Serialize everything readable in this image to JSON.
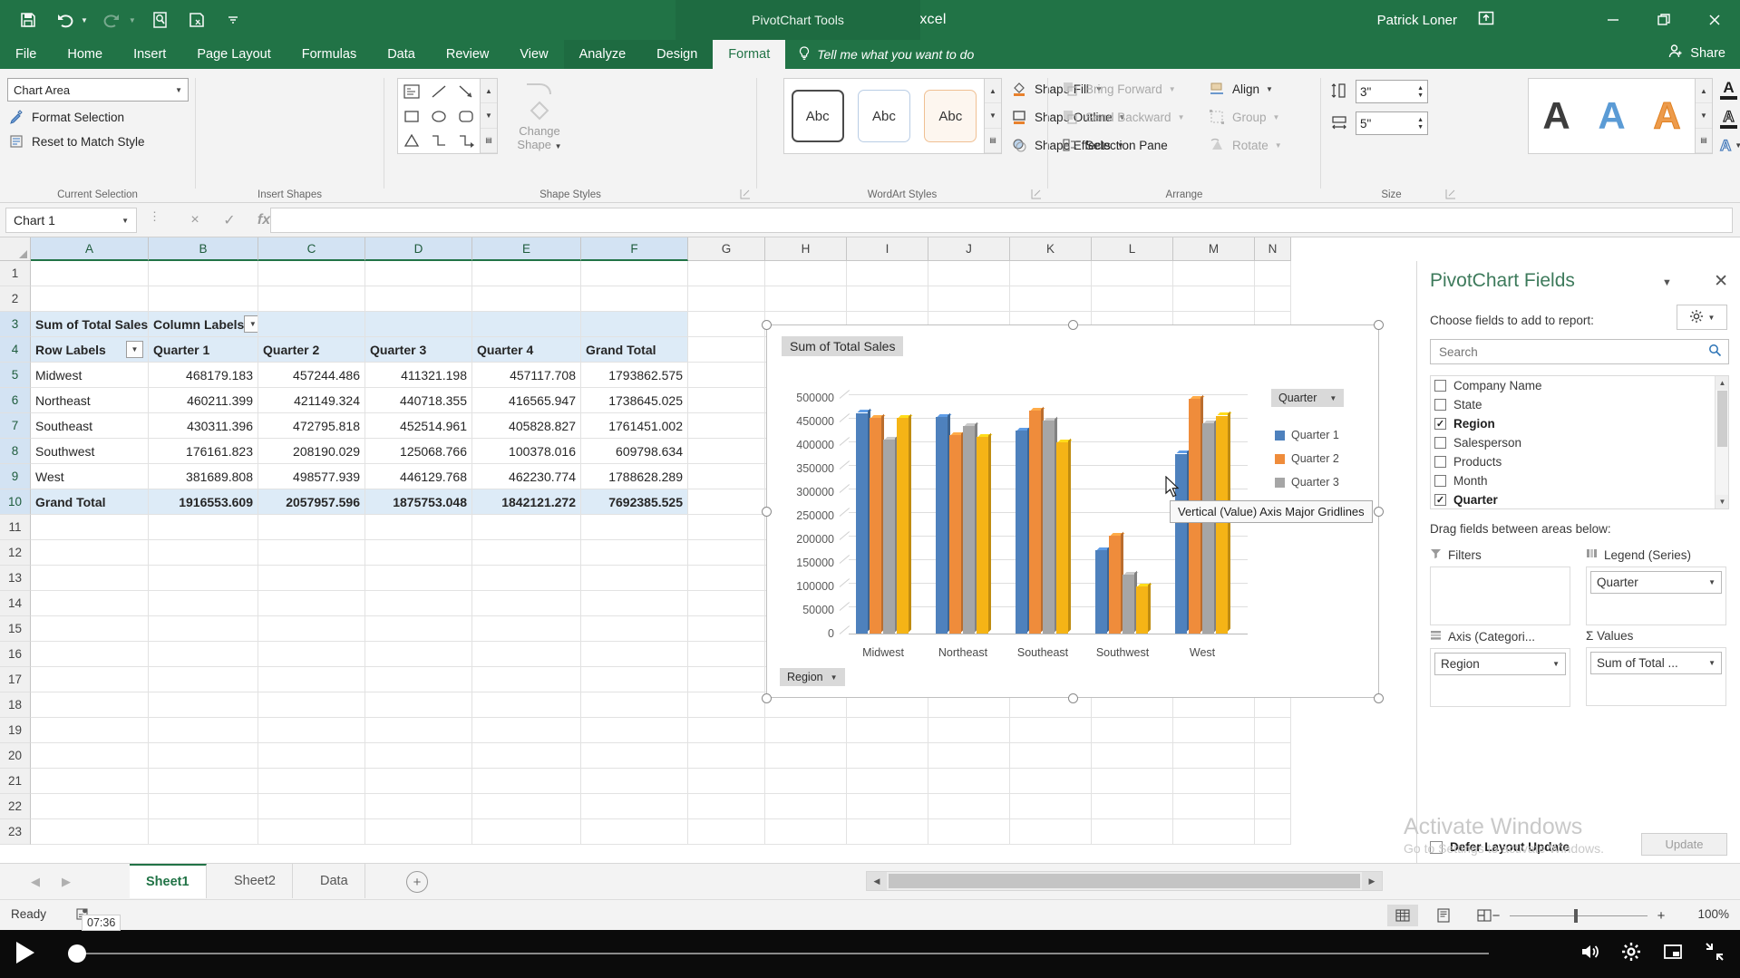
{
  "app": {
    "document_title": "Sales Data.xlsx  -  Excel",
    "context_banner": "PivotChart Tools",
    "account_name": "Patrick Loner",
    "share_label": "Share",
    "tell_me": "Tell me what you want to do"
  },
  "quick_access": [
    {
      "name": "save-icon",
      "enabled": true
    },
    {
      "name": "undo-icon",
      "enabled": true
    },
    {
      "name": "redo-icon",
      "enabled": false
    },
    {
      "name": "print-preview-icon",
      "enabled": true
    },
    {
      "name": "quick-print-icon",
      "enabled": true
    },
    {
      "name": "customize-qat-icon",
      "enabled": true
    }
  ],
  "tabs": [
    {
      "label": "File",
      "active": false,
      "context": false
    },
    {
      "label": "Home",
      "active": false,
      "context": false
    },
    {
      "label": "Insert",
      "active": false,
      "context": false
    },
    {
      "label": "Page Layout",
      "active": false,
      "context": false
    },
    {
      "label": "Formulas",
      "active": false,
      "context": false
    },
    {
      "label": "Data",
      "active": false,
      "context": false
    },
    {
      "label": "Review",
      "active": false,
      "context": false
    },
    {
      "label": "View",
      "active": false,
      "context": false
    },
    {
      "label": "Analyze",
      "active": false,
      "context": true
    },
    {
      "label": "Design",
      "active": false,
      "context": true
    },
    {
      "label": "Format",
      "active": true,
      "context": true
    }
  ],
  "ribbon": {
    "groups": [
      {
        "name": "Current Selection"
      },
      {
        "name": "Insert Shapes"
      },
      {
        "name": "Shape Styles"
      },
      {
        "name": "WordArt Styles"
      },
      {
        "name": "Arrange"
      },
      {
        "name": "Size"
      }
    ],
    "current_selection": {
      "selected_object": "Chart Area",
      "format_selection": "Format Selection",
      "reset_to_match_style": "Reset to Match Style"
    },
    "insert_shapes": {
      "change_shape": "Change Shape"
    },
    "shape_styles": {
      "gallery_samples": [
        "Abc",
        "Abc",
        "Abc"
      ],
      "shape_fill": "Shape Fill",
      "shape_outline": "Shape Outline",
      "shape_effects": "Shape Effects"
    },
    "wordart_styles": {
      "gallery_samples": [
        "A",
        "A",
        "A"
      ]
    },
    "arrange": {
      "bring_forward": "Bring Forward",
      "send_backward": "Send Backward",
      "selection_pane": "Selection Pane",
      "align": "Align",
      "group": "Group",
      "rotate": "Rotate"
    },
    "size": {
      "height_label": "Shape Height",
      "height_value": "3\"",
      "width_label": "Shape Width",
      "width_value": "5\""
    }
  },
  "formula_bar": {
    "name_box": "Chart 1",
    "formula_value": "",
    "cancel": "×",
    "enter": "✓",
    "insert_function": "fx"
  },
  "grid": {
    "columns": [
      "A",
      "B",
      "C",
      "D",
      "E",
      "F",
      "G",
      "H",
      "I",
      "J",
      "K",
      "L",
      "M",
      "N"
    ],
    "rows": [
      1,
      2,
      3,
      4,
      5,
      6,
      7,
      8,
      9,
      10,
      11,
      12,
      13,
      14,
      15,
      16,
      17,
      18,
      19,
      20,
      21,
      22,
      23
    ],
    "pivot": {
      "value_caption": "Sum of Total Sales",
      "column_labels": "Column Labels",
      "row_labels": "Row Labels",
      "headers": [
        "Quarter 1",
        "Quarter 2",
        "Quarter 3",
        "Quarter 4",
        "Grand Total"
      ],
      "rows": [
        {
          "region": "Midwest",
          "values": [
            "468179.183",
            "457244.486",
            "411321.198",
            "457117.708",
            "1793862.575"
          ]
        },
        {
          "region": "Northeast",
          "values": [
            "460211.399",
            "421149.324",
            "440718.355",
            "416565.947",
            "1738645.025"
          ]
        },
        {
          "region": "Southeast",
          "values": [
            "430311.396",
            "472795.818",
            "452514.961",
            "405828.827",
            "1761451.002"
          ]
        },
        {
          "region": "Southwest",
          "values": [
            "176161.823",
            "208190.029",
            "125068.766",
            "100378.016",
            "609798.634"
          ]
        },
        {
          "region": "West",
          "values": [
            "381689.808",
            "498577.939",
            "446129.768",
            "462230.774",
            "1788628.289"
          ]
        }
      ],
      "grand_total": {
        "label": "Grand Total",
        "values": [
          "1916553.609",
          "2057957.596",
          "1875753.048",
          "1842121.272",
          "7692385.525"
        ]
      }
    }
  },
  "chart_data": {
    "type": "bar",
    "title": "Sum of Total Sales",
    "categories": [
      "Midwest",
      "Northeast",
      "Southeast",
      "Southwest",
      "West"
    ],
    "series": [
      {
        "name": "Quarter 1",
        "color": "#4e81bd",
        "values": [
          468179.183,
          460211.399,
          430311.396,
          176161.823,
          381689.808
        ]
      },
      {
        "name": "Quarter 2",
        "color": "#ef8c3b",
        "values": [
          457244.486,
          421149.324,
          472795.818,
          208190.029,
          498577.939
        ]
      },
      {
        "name": "Quarter 3",
        "color": "#a6a6a6",
        "values": [
          411321.198,
          440718.355,
          452514.961,
          125068.766,
          446129.768
        ]
      },
      {
        "name": "Quarter 4",
        "color": "#f5b416",
        "values": [
          457117.708,
          416565.947,
          405828.827,
          100378.016,
          462230.774
        ]
      }
    ],
    "ytick_labels": [
      "500000",
      "450000",
      "400000",
      "350000",
      "300000",
      "250000",
      "200000",
      "150000",
      "100000",
      "50000",
      "0"
    ],
    "ylim": [
      0,
      500000
    ],
    "ymajor_step": 50000,
    "xlabel": "",
    "ylabel": "",
    "grid": true,
    "legend_position": "right",
    "series_field_button": "Quarter",
    "axis_field_button": "Region",
    "tooltip": "Vertical (Value) Axis Major Gridlines"
  },
  "pivot_pane": {
    "title": "PivotChart Fields",
    "choose_fields": "Choose fields to add to report:",
    "search_placeholder": "Search",
    "fields": [
      {
        "label": "Company Name",
        "checked": false
      },
      {
        "label": "State",
        "checked": false
      },
      {
        "label": "Region",
        "checked": true
      },
      {
        "label": "Salesperson",
        "checked": false
      },
      {
        "label": "Products",
        "checked": false
      },
      {
        "label": "Month",
        "checked": false
      },
      {
        "label": "Quarter",
        "checked": true
      }
    ],
    "drag_message": "Drag fields between areas below:",
    "zones": [
      {
        "name": "Filters",
        "items": []
      },
      {
        "name": "Legend (Series)",
        "items": [
          "Quarter"
        ]
      },
      {
        "name": "Axis (Categori...",
        "items": [
          "Region"
        ]
      },
      {
        "name": "Σ Values",
        "items": [
          "Sum of Total ..."
        ]
      }
    ],
    "defer_layout_update": "Defer Layout Update",
    "update_button": "Update"
  },
  "watermark": {
    "line1": "Activate Windows",
    "line2": "Go to Settings to activate Windows."
  },
  "sheet_tabs": [
    {
      "label": "Sheet1",
      "active": true
    },
    {
      "label": "Sheet2",
      "active": false
    },
    {
      "label": "Data",
      "active": false
    }
  ],
  "status_bar": {
    "mode": "Ready",
    "macro_recording_icon": "record-macro-icon",
    "time_chip": "07:36",
    "views": [
      {
        "name": "normal-view",
        "active": true
      },
      {
        "name": "page-layout-view",
        "active": false
      },
      {
        "name": "page-break-view",
        "active": false
      }
    ],
    "zoom_out": "−",
    "zoom_in": "+",
    "zoom_level": "100%"
  },
  "video_bar": {
    "play_icon": "play-icon",
    "volume_icon": "volume-icon",
    "settings_icon": "gear-icon",
    "pip_icon": "picture-in-picture-icon",
    "exit_fullscreen_icon": "exit-fullscreen-icon"
  }
}
